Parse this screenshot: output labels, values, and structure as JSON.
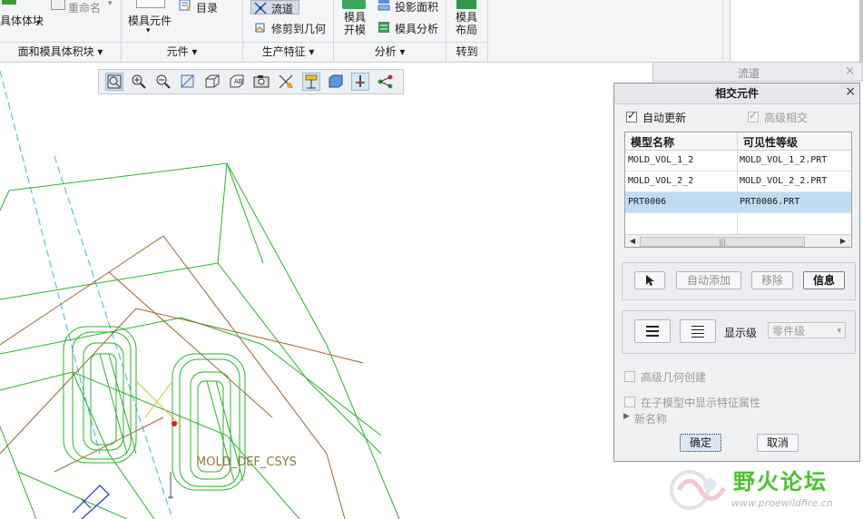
{
  "ribbon": {
    "solid_volume": "具体体块",
    "rename": "重命名",
    "mold_component": "模具元件",
    "catalog": "目录",
    "runner": "流道",
    "trim_to_geometry": "修剪到几何",
    "projected_area": "投影面积",
    "mold_open_l1": "模具",
    "mold_open_l2": "开模",
    "mold_analysis": "模具分析",
    "mold_layout_l1": "模具",
    "mold_layout_l2": "布局",
    "groups": {
      "face_volume": "面和模具体积块",
      "component": "元件",
      "production_feature": "生产特征",
      "analysis": "分析",
      "goto": "转到"
    }
  },
  "background_dialog": {
    "title": "流道",
    "close": "×"
  },
  "dialog": {
    "title": "相交元件",
    "close": "×",
    "auto_update": {
      "label": "自动更新",
      "checked": true
    },
    "advanced_intersect": {
      "label": "高级相交",
      "checked": true,
      "disabled": true
    },
    "table": {
      "headers": [
        "模型名称",
        "可见性等级"
      ],
      "rows": [
        [
          "MOLD_VOL_1_2",
          "MOLD_VOL_1_2.PRT"
        ],
        [
          "MOLD_VOL_2_2",
          "MOLD_VOL_2_2.PRT"
        ],
        [
          "PRT0006",
          "PRT0006.PRT"
        ]
      ],
      "selected_row": 2,
      "scroll_left": "◀",
      "scroll_right": "▶",
      "scroll_grip": "|||"
    },
    "buttons": {
      "auto_add": "自动添加",
      "remove": "移除",
      "info": "信息",
      "display_level_label": "显示级",
      "display_level_value": "零件级",
      "ok": "确定",
      "cancel": "取消"
    },
    "adv_geometry_create": "高级几何创建",
    "show_feature_props": "在子模型中显示特征属性",
    "new_name": "新名称"
  },
  "viewport": {
    "csys_label": "MOLD_DEF_CSYS"
  },
  "watermark": {
    "title": "野火论坛",
    "url": "www.proewildfire.cn"
  },
  "colors": {
    "geometry_green": "#2ab32a",
    "geometry_brown": "#a0622a",
    "axis_cyan": "#38b8e8",
    "selection_blue": "#bfdcf2",
    "watermark_green": "#49c22e"
  }
}
